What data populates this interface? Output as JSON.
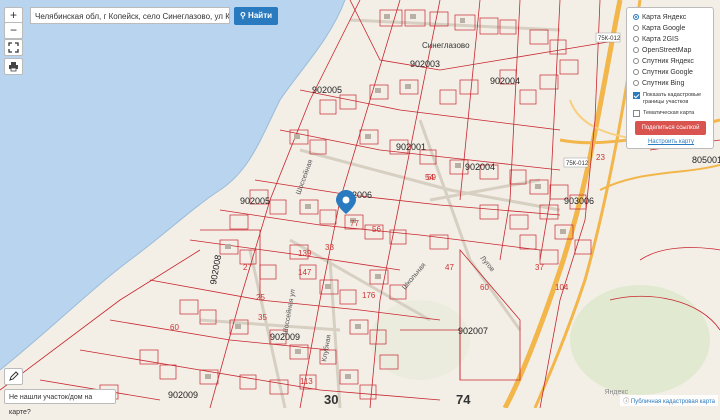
{
  "search": {
    "value": "Челябинская обл, г Копейск, село Синеглазово, ул Клубная",
    "button_label": "Найти",
    "button_icon": "search-icon"
  },
  "controls": {
    "zoom_in": "+",
    "zoom_out": "−",
    "fullscreen_icon": "fullscreen-icon",
    "print_icon": "printer-icon",
    "edit_icon": "pencil-icon"
  },
  "layers": {
    "options": [
      {
        "label": "Карта Яндекс",
        "selected": true
      },
      {
        "label": "Карта Google",
        "selected": false
      },
      {
        "label": "Карта 2GIS",
        "selected": false
      },
      {
        "label": "OpenStreetMap",
        "selected": false
      },
      {
        "label": "Спутник Яндекс",
        "selected": false
      },
      {
        "label": "Спутник Google",
        "selected": false
      },
      {
        "label": "Спутник Bing",
        "selected": false
      }
    ],
    "checkbox_cadastral": {
      "line1": "Показать кадастровые",
      "line2": "границы участков",
      "checked": true
    },
    "checkbox_thematic": {
      "label": "Тематическая карта",
      "checked": false
    },
    "share_button": "Поделиться ссылкой",
    "setup_link": "Настроить карту"
  },
  "bottom": {
    "not_found": "Не нашли участок/дом на карте?",
    "attribution_link": "Публичная кадастровая карта",
    "yandex": "Яндекс"
  },
  "map": {
    "quarters": [
      "902003",
      "902005",
      "902004",
      "902001",
      "902006",
      "902005",
      "902008",
      "902009",
      "902009",
      "902007",
      "805001",
      "903006",
      "902004"
    ],
    "big_numbers": [
      "74",
      "30"
    ],
    "village": "Синеглазово",
    "streets": [
      "Шоссейная",
      "Клубная",
      "Школьная",
      "Шоссейная ул",
      "Лугов"
    ],
    "road_labels": [
      "75К-012",
      "75К-012"
    ],
    "lot_numbers": [
      "56",
      "23",
      "59",
      "77",
      "27",
      "25",
      "33",
      "139",
      "147",
      "176",
      "113",
      "54",
      "35",
      "47",
      "60",
      "37",
      "104",
      "60"
    ],
    "colors": {
      "water": "#b8d4ee",
      "land": "#f3efe7",
      "cadastral": "#c8262e",
      "road": "#f2b64a",
      "marker": "#2a7ac0"
    }
  }
}
